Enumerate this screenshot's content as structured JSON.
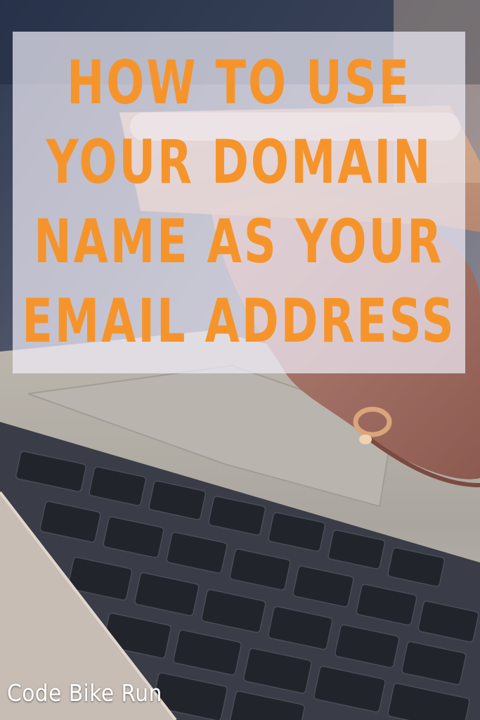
{
  "headline": {
    "lines": [
      "HOW TO USE",
      "YOUR DOMAIN",
      "NAME AS YOUR",
      "EMAIL ADDRESS"
    ]
  },
  "watermark": "Code Bike Run",
  "colors": {
    "headline": "#f6942c",
    "overlay": "#eeecf6",
    "watermark": "#ffffff"
  },
  "photo": {
    "subject": "hand with ring typing on a silver laptop keyboard while holding a smartphone"
  }
}
